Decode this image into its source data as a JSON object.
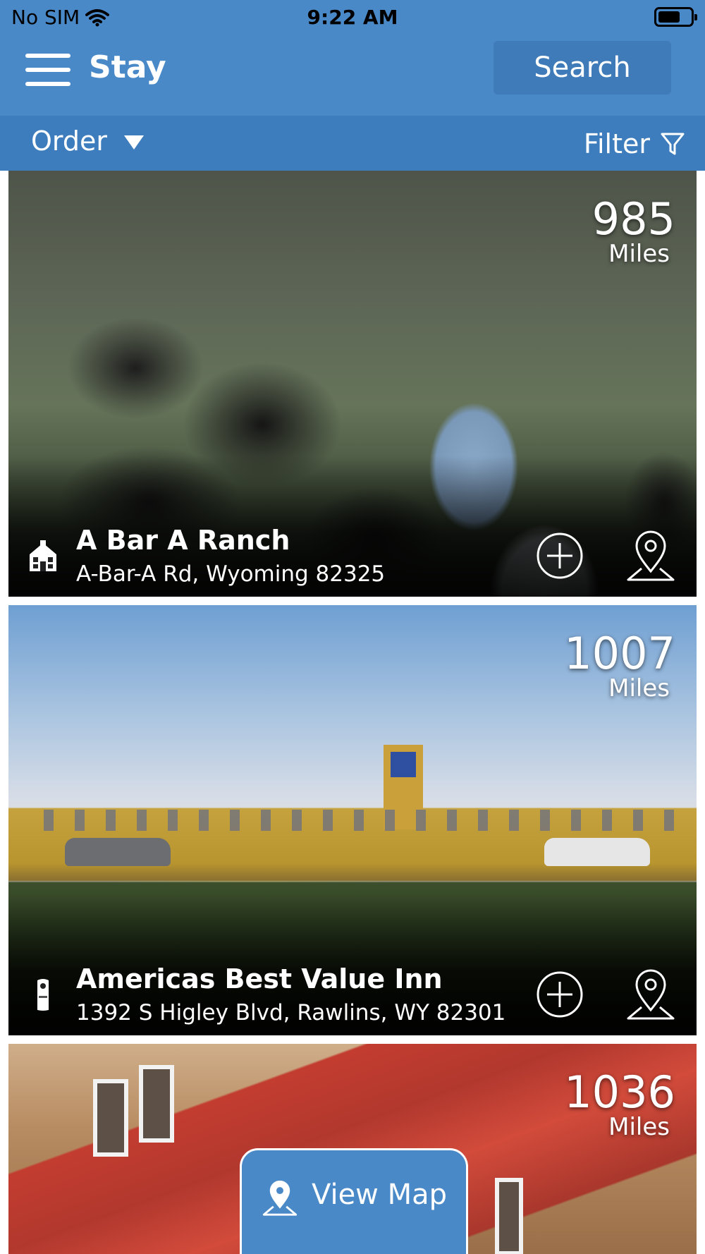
{
  "status_bar": {
    "carrier": "No SIM",
    "time": "9:22 AM"
  },
  "nav": {
    "title": "Stay",
    "search_label": "Search"
  },
  "toolbar": {
    "order_label": "Order",
    "filter_label": "Filter"
  },
  "listings": [
    {
      "name": "A Bar A Ranch",
      "address": "A-Bar-A Rd, Wyoming 82325",
      "distance": "985",
      "unit": "Miles",
      "type_icon": "house-icon"
    },
    {
      "name": "Americas Best Value Inn",
      "address": "1392 S Higley Blvd, Rawlins, WY 82301",
      "distance": "1007",
      "unit": "Miles",
      "type_icon": "room-service-hanger-icon"
    },
    {
      "distance": "1036",
      "unit": "Miles"
    }
  ],
  "view_map": {
    "label": "View Map"
  },
  "colors": {
    "primary": "#4a89c8",
    "subbar": "#3e7dbd",
    "search_button": "#3f7bb8"
  }
}
